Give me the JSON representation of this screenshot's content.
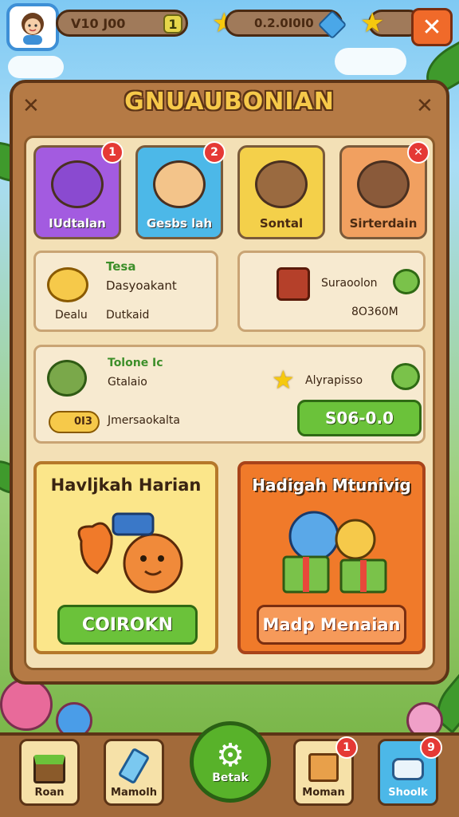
{
  "topbar": {
    "coins": "V10 J00",
    "coin_plus": "1",
    "gems": "0.2.0I0I0",
    "close": "✕"
  },
  "board": {
    "title": "GNUAUBONIAN"
  },
  "categories": [
    {
      "label": "IUdtalan",
      "badge": "1",
      "color": "#a35be0"
    },
    {
      "label": "Gesbs lah",
      "badge": "2",
      "color": "#4cb8e8"
    },
    {
      "label": "Sontal",
      "badge": "",
      "color": "#f4d04a"
    },
    {
      "label": "Sirterdain",
      "badge": "✕",
      "color": "#f1a060"
    }
  ],
  "info_left": {
    "label_green": "Tesa",
    "line1": "Dasyoakant",
    "line2_a": "Dealu",
    "line2_b": "Dutkaid"
  },
  "info_right": {
    "label": "Suraoolon",
    "value": "8O360M"
  },
  "wide_panel": {
    "label_green": "Tolone Ic",
    "line1": "Gtalaio",
    "coin_value": "0I3",
    "line2": "Jmersaokalta",
    "right_label": "Alyrapisso",
    "button": "S06-0.0"
  },
  "daily": {
    "title": "Havljkah Harian",
    "button": "COIROKN"
  },
  "gift": {
    "title": "Hadigah Mtunivig",
    "button": "Madp Menaian"
  },
  "nav": [
    {
      "label": "Roan",
      "badge": ""
    },
    {
      "label": "Mamolh",
      "badge": ""
    },
    {
      "label": "Betak",
      "badge": ""
    },
    {
      "label": "Moman",
      "badge": "1"
    },
    {
      "label": "Shoolk",
      "badge": "9"
    }
  ]
}
